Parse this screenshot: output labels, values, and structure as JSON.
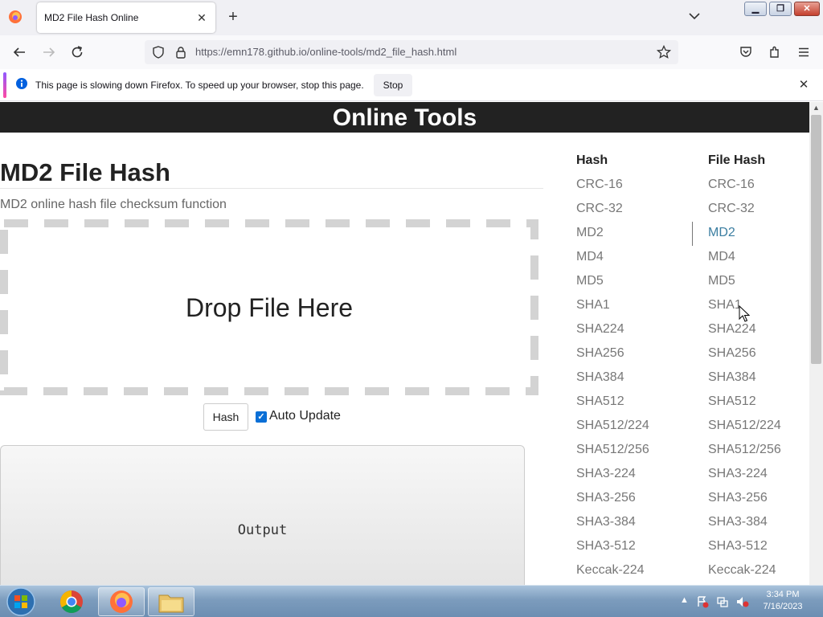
{
  "browser": {
    "tab_title": "MD2 File Hash Online",
    "url_host": "https://emn178.github.io",
    "url_path": "/online-tools/md2_file_hash.html",
    "notification_text": "This page is slowing down Firefox. To speed up your browser, stop this page.",
    "notification_button": "Stop"
  },
  "site": {
    "header_title": "Online Tools"
  },
  "main": {
    "title": "MD2 File Hash",
    "subtitle": "MD2 online hash file checksum function",
    "drop_text": "Drop File Here",
    "hash_button": "Hash",
    "auto_update_label": "Auto Update",
    "auto_update_checked": true,
    "output_placeholder": "Output"
  },
  "sidebar": {
    "hash_heading": "Hash",
    "file_hash_heading": "File Hash",
    "hash_items": [
      "CRC-16",
      "CRC-32",
      "MD2",
      "MD4",
      "MD5",
      "SHA1",
      "SHA224",
      "SHA256",
      "SHA384",
      "SHA512",
      "SHA512/224",
      "SHA512/256",
      "SHA3-224",
      "SHA3-256",
      "SHA3-384",
      "SHA3-512",
      "Keccak-224"
    ],
    "file_hash_items": [
      "CRC-16",
      "CRC-32",
      "MD2",
      "MD4",
      "MD5",
      "SHA1",
      "SHA224",
      "SHA256",
      "SHA384",
      "SHA512",
      "SHA512/224",
      "SHA512/256",
      "SHA3-224",
      "SHA3-256",
      "SHA3-384",
      "SHA3-512",
      "Keccak-224"
    ],
    "active_file_hash": "MD2",
    "active_color": "#3b7ea1",
    "link_color": "#777777"
  },
  "taskbar": {
    "time": "3:34 PM",
    "date": "7/16/2023"
  }
}
